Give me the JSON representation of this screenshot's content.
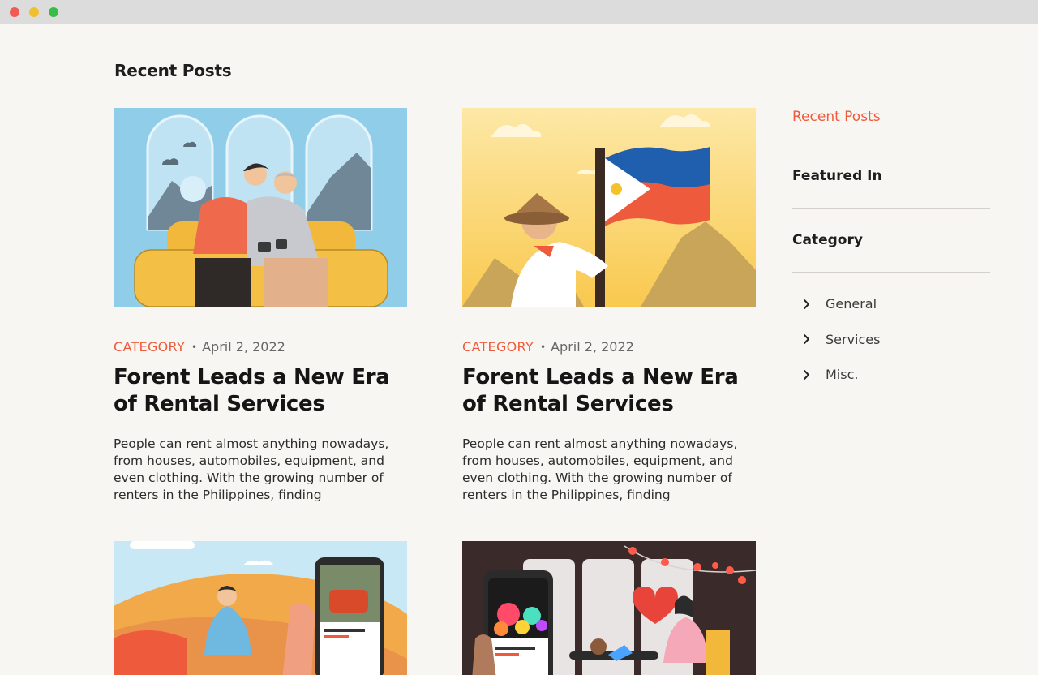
{
  "window": {
    "controls": [
      "close",
      "minimize",
      "maximize"
    ]
  },
  "main": {
    "section_title": "Recent Posts"
  },
  "posts": [
    {
      "category": "CATEGORY",
      "date": "April 2, 2022",
      "title": "Forent Leads a New Era of Rental Services",
      "excerpt": "People can rent almost anything nowadays, from houses, automobiles, equipment, and even clothing. With the growing number of renters in the Philippines, finding",
      "image": "couple-on-sofa-illustration"
    },
    {
      "category": "CATEGORY",
      "date": "April 2, 2022",
      "title": "Forent Leads a New Era of Rental Services",
      "excerpt": "People can rent almost anything nowadays, from houses, automobiles, equipment, and even clothing. With the growing number of renters in the Philippines, finding",
      "image": "man-with-philippine-flag-illustration"
    },
    {
      "image": "car-rental-phone-illustration"
    },
    {
      "image": "date-night-phone-illustration"
    }
  ],
  "sidebar": {
    "tabs": [
      {
        "label": "Recent Posts",
        "active": true
      },
      {
        "label": "Featured In",
        "active": false
      },
      {
        "label": "Category",
        "active": false
      }
    ],
    "categories": [
      {
        "label": "General",
        "icon": "chevron-right-icon"
      },
      {
        "label": "Services",
        "icon": "chevron-right-icon"
      },
      {
        "label": "Misc.",
        "icon": "chevron-right-icon"
      }
    ]
  },
  "colors": {
    "accent": "#ee5b3c",
    "background": "#f8f6f2",
    "divider": "#d4d0ca"
  }
}
